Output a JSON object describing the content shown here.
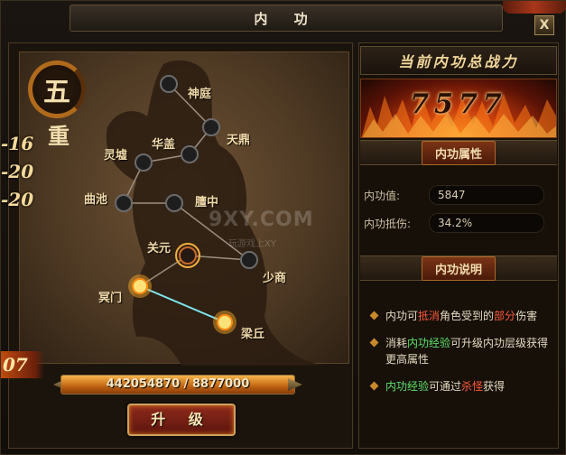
{
  "window": {
    "title": "内 功",
    "close_label": "X"
  },
  "tier": {
    "rank_char": "五",
    "rank_suffix": "重"
  },
  "side_stats": [
    "-16",
    "-20",
    "-20"
  ],
  "points_left": "07",
  "meridian_nodes": [
    {
      "id": "shenting",
      "label": "神庭",
      "state": "inactive"
    },
    {
      "id": "tianding",
      "label": "天鼎",
      "state": "inactive"
    },
    {
      "id": "huagai",
      "label": "华盖",
      "state": "inactive"
    },
    {
      "id": "lingxu",
      "label": "灵墟",
      "state": "inactive"
    },
    {
      "id": "quchi",
      "label": "曲池",
      "state": "inactive"
    },
    {
      "id": "tanzhong",
      "label": "膻中",
      "state": "inactive"
    },
    {
      "id": "guanyuan",
      "label": "关元",
      "state": "selected"
    },
    {
      "id": "shaoshang",
      "label": "少商",
      "state": "inactive"
    },
    {
      "id": "mingmen",
      "label": "冥门",
      "state": "active"
    },
    {
      "id": "liangqiu",
      "label": "梁丘",
      "state": "active"
    }
  ],
  "experience": {
    "text": "442054870 / 8877000",
    "fill_fraction": 1.0
  },
  "upgrade_button": "升 级",
  "power": {
    "header": "当前内功总战力",
    "value": "7577"
  },
  "attributes": {
    "title": "内功属性",
    "rows": [
      {
        "label": "内功值:",
        "value": "5847"
      },
      {
        "label": "内功抵伤:",
        "value": "34.2%"
      }
    ]
  },
  "description": {
    "title": "内功说明",
    "items": [
      {
        "parts": [
          {
            "t": "内功可",
            "c": ""
          },
          {
            "t": "抵消",
            "c": "red"
          },
          {
            "t": "角色受到的",
            "c": ""
          },
          {
            "t": "部分",
            "c": "red"
          },
          {
            "t": "伤害",
            "c": ""
          }
        ]
      },
      {
        "parts": [
          {
            "t": "消耗",
            "c": ""
          },
          {
            "t": "内功经验",
            "c": "green"
          },
          {
            "t": "可升级内功层级获得更高属性",
            "c": ""
          }
        ]
      },
      {
        "parts": [
          {
            "t": "内功经验",
            "c": "green"
          },
          {
            "t": "可通过",
            "c": ""
          },
          {
            "t": "杀怪",
            "c": "red"
          },
          {
            "t": "获得",
            "c": ""
          }
        ]
      }
    ]
  },
  "watermark": {
    "main": "9XY.COM",
    "sub": "玩游戏上XY"
  },
  "colors": {
    "accent_orange": "#e07a26",
    "highlight_red": "#ff5a3c",
    "highlight_green": "#5fe06a",
    "link_cyan": "#7fe8f0"
  }
}
